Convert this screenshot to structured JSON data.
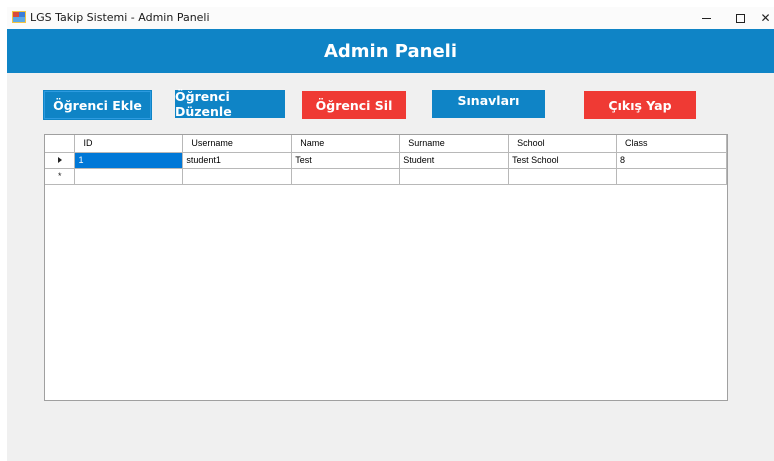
{
  "window": {
    "title": "LGS Takip Sistemi - Admin Paneli",
    "close_glyph": "✕"
  },
  "header": {
    "title": "Admin Paneli"
  },
  "toolbar": {
    "add_label": "Öğrenci Ekle",
    "edit_label": "Öğrenci Düzenle",
    "delete_label": "Öğrenci Sil",
    "exams_label": "Sınavları",
    "exit_label": "Çıkış Yap"
  },
  "grid": {
    "columns": [
      "ID",
      "Username",
      "Name",
      "Surname",
      "School",
      "Class"
    ],
    "rows": [
      [
        "1",
        "student1",
        "Test",
        "Student",
        "Test School",
        "8"
      ]
    ],
    "new_row_marker": "*"
  },
  "colors": {
    "accent_blue": "#0f84c6",
    "accent_red": "#ef3a34",
    "selection": "#0078d7"
  }
}
